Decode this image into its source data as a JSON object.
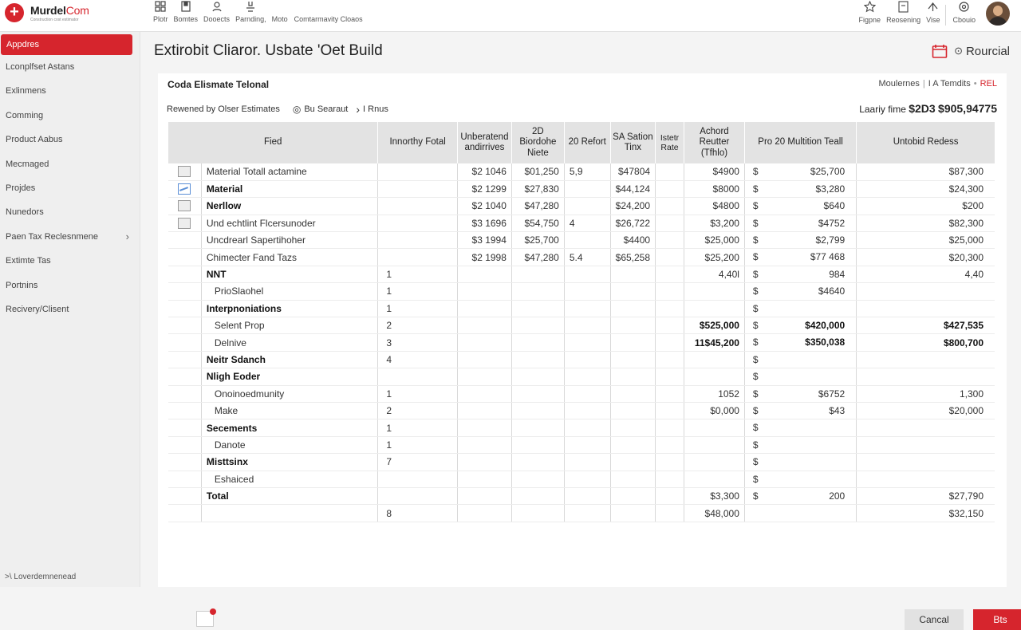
{
  "app": {
    "name_a": "Murdel",
    "name_b": "Com",
    "tagline": "Construction cost estimator"
  },
  "topnav": {
    "items": [
      "Plotr",
      "Bomtes",
      "Dooects",
      "Parnding,",
      "Moto"
    ],
    "extra": "Comtarmavity Cloaos"
  },
  "top_right": {
    "items": [
      "Figpne",
      "Reosening",
      "Vise",
      "Cbouio"
    ]
  },
  "sidebar": {
    "items": [
      "Appdres",
      "Lconplfset Astans",
      "Exlinmens",
      "Comming",
      "Product Aabus",
      "Mecmaged",
      "Projdes",
      "Nunedors",
      "Paen Tax Reclesnmene",
      "Extimte Tas",
      "Portnins",
      "Recivery/Clisent"
    ],
    "footer": ">\\ Loverdemnenead"
  },
  "page": {
    "title": "Extirobit Cliaror. Usbate 'Oet Build",
    "action": "Rourcial"
  },
  "card": {
    "title": "Coda Elismate Telonal",
    "links": [
      "Moulernes",
      "I A Temdits",
      "REL"
    ],
    "subtitle": "Rewened by Olser Estimates",
    "target": "Bu Searaut",
    "breadcrumb": "I Rnus",
    "totals_label": "Laariy fime",
    "totals_a": "$2D3",
    "totals_b": "$905,94775"
  },
  "table": {
    "headers": [
      "Fied",
      "Innorthy Fotal",
      "Unberatend andirrives",
      "2D Biordohe Niete",
      "20 Refort",
      "SA Sation Tinx",
      "Istetr Rate",
      "Achord Reutter (Tfhlo)",
      "Pro 20 Multition Teall",
      "Untobid Redess"
    ],
    "rows": [
      {
        "check": "off",
        "label": "Material Totall actamine",
        "bold": false,
        "indent": false,
        "qty": "",
        "c2": "$2 1046",
        "c3": "$01,250",
        "c4": "5,9",
        "c5": "$47804",
        "c7": "$4900",
        "cur": "$",
        "c8": "$25,700",
        "c9": "$87,300"
      },
      {
        "check": "on",
        "label": "Material",
        "bold": true,
        "indent": false,
        "qty": "",
        "c2": "$2 1299",
        "c3": "$27,830",
        "c4": "",
        "c5": "$44,124",
        "c7": "$8000",
        "cur": "$",
        "c8": "$3,280",
        "c9": "$24,300"
      },
      {
        "check": "off",
        "label": "Nerllow",
        "bold": true,
        "indent": false,
        "qty": "",
        "c2": "$2 1040",
        "c3": "$47,280",
        "c4": "",
        "c5": "$24,200",
        "c7": "$4800",
        "cur": "$",
        "c8": "$640",
        "c9": "$200"
      },
      {
        "check": "off",
        "label": "Und echtlint Flcersunoder",
        "bold": false,
        "indent": false,
        "qty": "",
        "c2": "$3 1696",
        "c3": "$54,750",
        "c4": "4",
        "c5": "$26,722",
        "c7": "$3,200",
        "cur": "$",
        "c8": "$4752",
        "c9": "$82,300"
      },
      {
        "check": "",
        "label": "Uncdrearl Sapertihoher",
        "bold": false,
        "indent": false,
        "qty": "",
        "c2": "$3 1994",
        "c3": "$25,700",
        "c4": "",
        "c5": "$4400",
        "c7": "$25,000",
        "cur": "$",
        "c8": "$2,799",
        "c9": "$25,000"
      },
      {
        "check": "",
        "label": "Chimecter Fand Tazs",
        "bold": false,
        "indent": false,
        "qty": "",
        "c2": "$2 1998",
        "c3": "$47,280",
        "c4": "5.4",
        "c5": "$65,258",
        "c7": "$25,200",
        "cur": "$",
        "c8": "$77 468",
        "c9": "$20,300"
      },
      {
        "check": "",
        "label": "NNT",
        "bold": true,
        "indent": false,
        "qty": "1",
        "c2": "",
        "c3": "",
        "c4": "",
        "c5": "",
        "c7": "4,40l",
        "cur": "$",
        "c8": "984",
        "c9": "4,40"
      },
      {
        "check": "",
        "label": "PrioSlaohel",
        "bold": false,
        "indent": true,
        "qty": "1",
        "c2": "",
        "c3": "",
        "c4": "",
        "c5": "",
        "c7": "",
        "cur": "$",
        "c8": "$4640",
        "c9": ""
      },
      {
        "check": "",
        "label": "Interpnoniations",
        "bold": true,
        "indent": false,
        "qty": "1",
        "c2": "",
        "c3": "",
        "c4": "",
        "c5": "",
        "c7": "",
        "cur": "$",
        "c8": "",
        "c9": ""
      },
      {
        "check": "",
        "label": "Selent Prop",
        "bold": false,
        "indent": true,
        "qty": "2",
        "c2": "",
        "c3": "",
        "c4": "",
        "c5": "",
        "c7": "$525,000",
        "cur": "$",
        "c8": "$420,000",
        "c9": "$427,535",
        "strong": true
      },
      {
        "check": "",
        "label": "Delnive",
        "bold": false,
        "indent": true,
        "qty": "3",
        "c2": "",
        "c3": "",
        "c4": "",
        "c5": "",
        "c7": "11$45,200",
        "cur": "$",
        "c8": "$350,038",
        "c9": "$800,700",
        "strong": true
      },
      {
        "check": "",
        "label": "Neitr Sdanch",
        "bold": true,
        "indent": false,
        "qty": "4",
        "c2": "",
        "c3": "",
        "c4": "",
        "c5": "",
        "c7": "",
        "cur": "$",
        "c8": "",
        "c9": ""
      },
      {
        "check": "",
        "label": "Nligh Eoder",
        "bold": true,
        "indent": false,
        "qty": "",
        "c2": "",
        "c3": "",
        "c4": "",
        "c5": "",
        "c7": "",
        "cur": "$",
        "c8": "",
        "c9": ""
      },
      {
        "check": "",
        "label": "Onoinoedmunity",
        "bold": false,
        "indent": true,
        "qty": "1",
        "c2": "",
        "c3": "",
        "c4": "",
        "c5": "",
        "c7": "1052",
        "cur": "$",
        "c8": "$6752",
        "c9": "1,300"
      },
      {
        "check": "",
        "label": "Make",
        "bold": false,
        "indent": true,
        "qty": "2",
        "c2": "",
        "c3": "",
        "c4": "",
        "c5": "",
        "c7": "$0,000",
        "cur": "$",
        "c8": "$43",
        "c9": "$20,000"
      },
      {
        "check": "",
        "label": "Secements",
        "bold": true,
        "indent": false,
        "qty": "1",
        "c2": "",
        "c3": "",
        "c4": "",
        "c5": "",
        "c7": "",
        "cur": "$",
        "c8": "",
        "c9": ""
      },
      {
        "check": "",
        "label": "Danote",
        "bold": false,
        "indent": true,
        "qty": "1",
        "c2": "",
        "c3": "",
        "c4": "",
        "c5": "",
        "c7": "",
        "cur": "$",
        "c8": "",
        "c9": ""
      },
      {
        "check": "",
        "label": "Misttsinx",
        "bold": true,
        "indent": false,
        "qty": "7",
        "c2": "",
        "c3": "",
        "c4": "",
        "c5": "",
        "c7": "",
        "cur": "$",
        "c8": "",
        "c9": ""
      },
      {
        "check": "",
        "label": "Eshaiced",
        "bold": false,
        "indent": true,
        "qty": "",
        "c2": "",
        "c3": "",
        "c4": "",
        "c5": "",
        "c7": "",
        "cur": "$",
        "c8": "",
        "c9": ""
      },
      {
        "check": "",
        "label": "Total",
        "bold": true,
        "indent": false,
        "qty": "",
        "c2": "",
        "c3": "",
        "c4": "",
        "c5": "",
        "c7": "$3,300",
        "cur": "$",
        "c8": "200",
        "c9": "$27,790"
      },
      {
        "check": "",
        "label": "",
        "bold": false,
        "indent": false,
        "qty": "8",
        "c2": "",
        "c3": "",
        "c4": "",
        "c5": "",
        "c7": "$48,000",
        "cur": "",
        "c8": "",
        "c9": "$32,150"
      }
    ]
  },
  "buttons": {
    "cancel": "Cancal",
    "save": "Bts"
  }
}
